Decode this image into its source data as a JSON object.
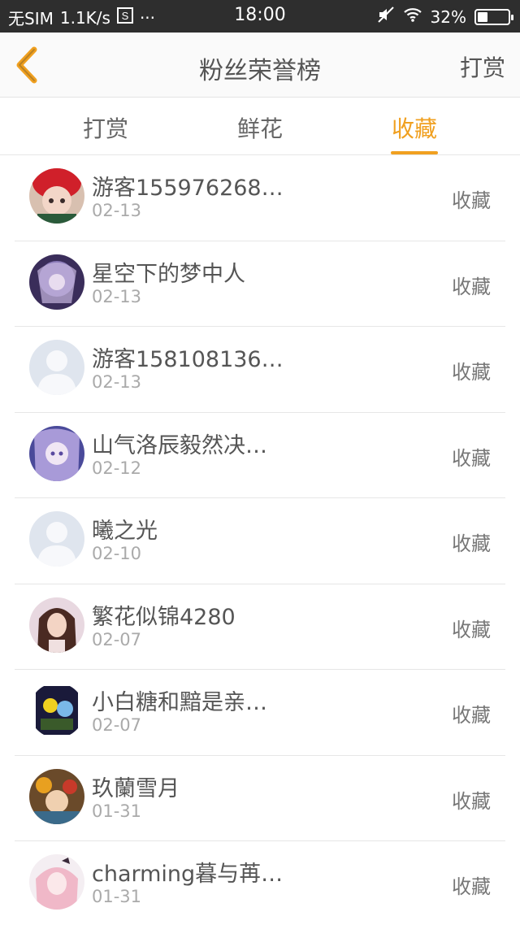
{
  "status": {
    "carrier": "无SIM",
    "speed": "1.1K/s",
    "time": "18:00",
    "battery_text": "32%",
    "battery_level": 0.32,
    "dots": "···"
  },
  "navbar": {
    "title": "粉丝荣誉榜",
    "action": "打赏",
    "accent": "#f0a020"
  },
  "tabs": [
    {
      "label": "打赏"
    },
    {
      "label": "鲜花"
    },
    {
      "label": "收藏"
    }
  ],
  "active_tab": 2,
  "fans": [
    {
      "name": "游客155976268…",
      "date": "02-13",
      "tag": "收藏",
      "avatar": "red-hat-doll"
    },
    {
      "name": "星空下的梦中人",
      "date": "02-13",
      "tag": "收藏",
      "avatar": "anime-purple"
    },
    {
      "name": "游客158108136…",
      "date": "02-13",
      "tag": "收藏",
      "avatar": "default"
    },
    {
      "name": "山气洛辰毅然决…",
      "date": "02-12",
      "tag": "收藏",
      "avatar": "anime-blue"
    },
    {
      "name": "曦之光",
      "date": "02-10",
      "tag": "收藏",
      "avatar": "default"
    },
    {
      "name": "繁花似锦4280",
      "date": "02-07",
      "tag": "收藏",
      "avatar": "woman-portrait"
    },
    {
      "name": "小白糖和黯是亲…",
      "date": "02-07",
      "tag": "收藏",
      "avatar": "anime-dark"
    },
    {
      "name": "玖蘭雪月",
      "date": "01-31",
      "tag": "收藏",
      "avatar": "anime-colorful"
    },
    {
      "name": "charming暮与苒…",
      "date": "01-31",
      "tag": "收藏",
      "avatar": "anime-pink"
    }
  ]
}
